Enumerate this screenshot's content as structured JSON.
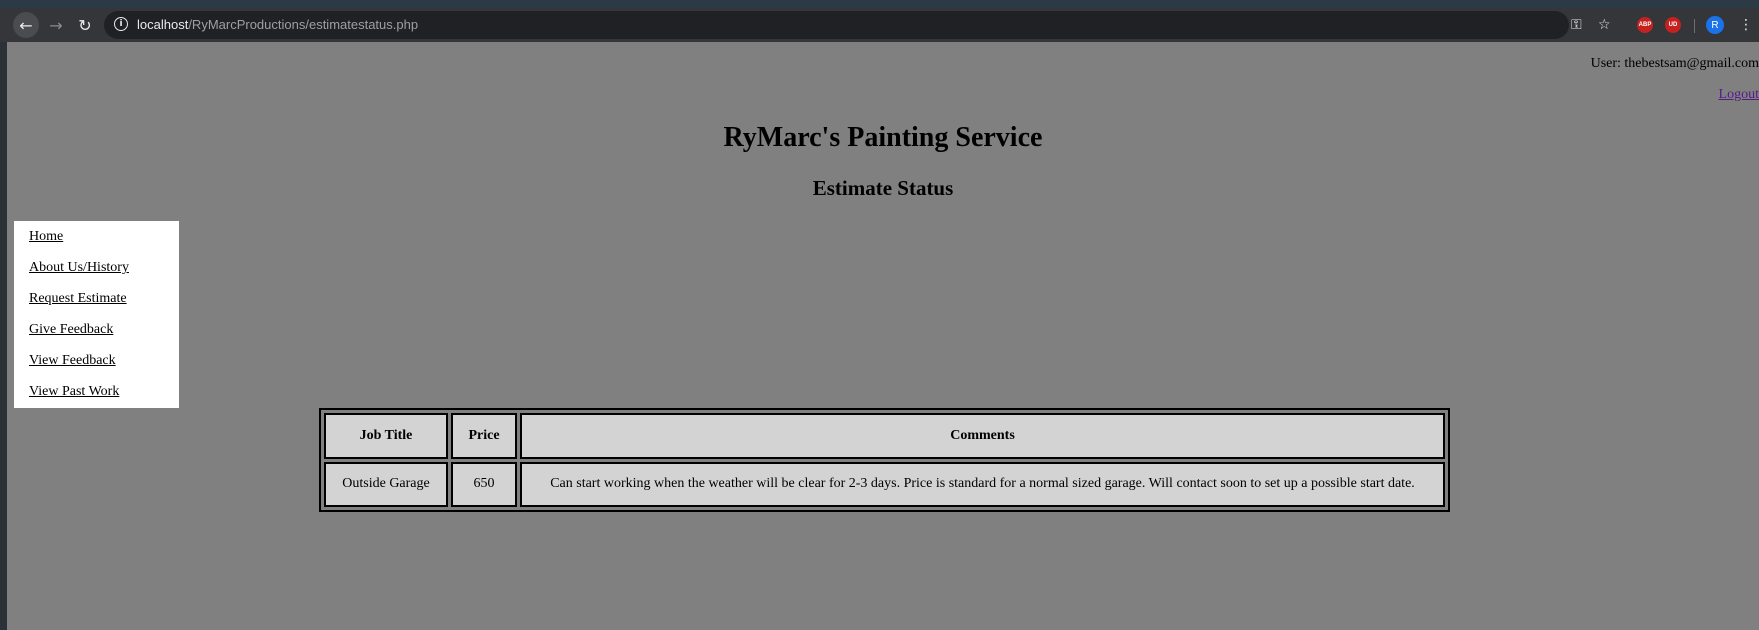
{
  "browser": {
    "url_host": "localhost",
    "url_path": "/RyMarcProductions/estimatestatus.php",
    "profile_initial": "R",
    "extensions": [
      "ABP",
      "UD"
    ]
  },
  "header": {
    "user_label": "User: thebestsam@gmail.com",
    "logout_label": "Logout",
    "site_title": "RyMarc's Painting Service",
    "page_title": "Estimate Status"
  },
  "sidebar": {
    "items": [
      {
        "label": "Home"
      },
      {
        "label": "About Us/History"
      },
      {
        "label": "Request Estimate"
      },
      {
        "label": "Give Feedback"
      },
      {
        "label": "View Feedback"
      },
      {
        "label": "View Past Work"
      }
    ]
  },
  "table": {
    "headers": [
      "Job Title",
      "Price",
      "Comments"
    ],
    "rows": [
      [
        "Outside Garage",
        "650",
        "Can start working when the weather will be clear for 2-3 days. Price is standard for a normal sized garage. Will contact soon to set up a possible start date."
      ]
    ]
  },
  "colors": {
    "page_bg": "#808080",
    "cell_bg": "#d3d3d3",
    "sidebar_bg": "#ffffff"
  }
}
